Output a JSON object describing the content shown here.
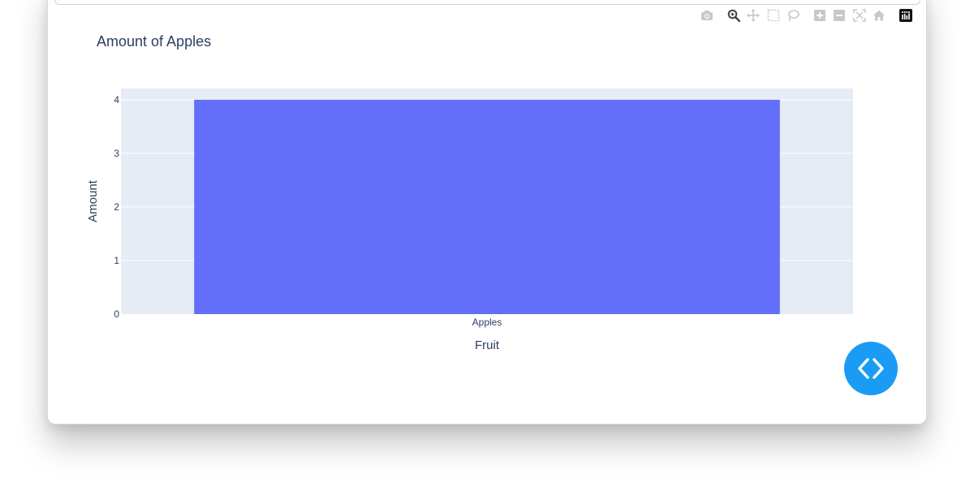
{
  "colors": {
    "bar": "#636efa",
    "plot_bg": "#e5ecf6",
    "text": "#2a3f5f",
    "grid": "#ffffff",
    "fab": "#1a9cf5",
    "modebar_icon": "#c8c8c8",
    "modebar_active": "#444444"
  },
  "modebar": {
    "icons": [
      "camera-icon",
      "zoom-icon",
      "pan-icon",
      "box-select-icon",
      "lasso-select-icon",
      "zoom-in-icon",
      "zoom-out-icon",
      "autoscale-icon",
      "reset-axes-icon",
      "plotly-logo-icon"
    ]
  },
  "fab": {
    "icon": "code-icon"
  },
  "chart_data": {
    "type": "bar",
    "title": "Amount of Apples",
    "xlabel": "Fruit",
    "ylabel": "Amount",
    "categories": [
      "Apples"
    ],
    "values": [
      4
    ],
    "ylim": [
      0,
      4.21
    ],
    "yticks": [
      "0",
      "1",
      "2",
      "3",
      "4"
    ],
    "grid": true,
    "legend": "none"
  }
}
